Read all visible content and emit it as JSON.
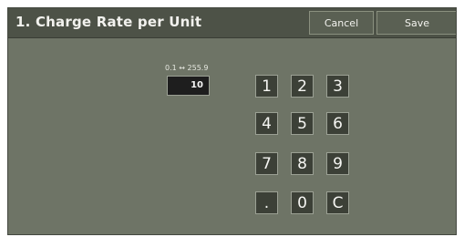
{
  "header": {
    "title": "1. Charge Rate per Unit",
    "cancel_label": "Cancel",
    "save_label": "Save"
  },
  "input": {
    "range": "0.1 ↔ 255.9",
    "value": "10"
  },
  "keypad": {
    "k1": "1",
    "k2": "2",
    "k3": "3",
    "k4": "4",
    "k5": "5",
    "k6": "6",
    "k7": "7",
    "k8": "8",
    "k9": "9",
    "dot": ".",
    "k0": "0",
    "clear": "C"
  },
  "colors": {
    "panel_bg": "#6e7466",
    "title_bar_bg": "#4d5247",
    "key_bg": "#3c4037",
    "field_bg": "#1e1e1e"
  }
}
